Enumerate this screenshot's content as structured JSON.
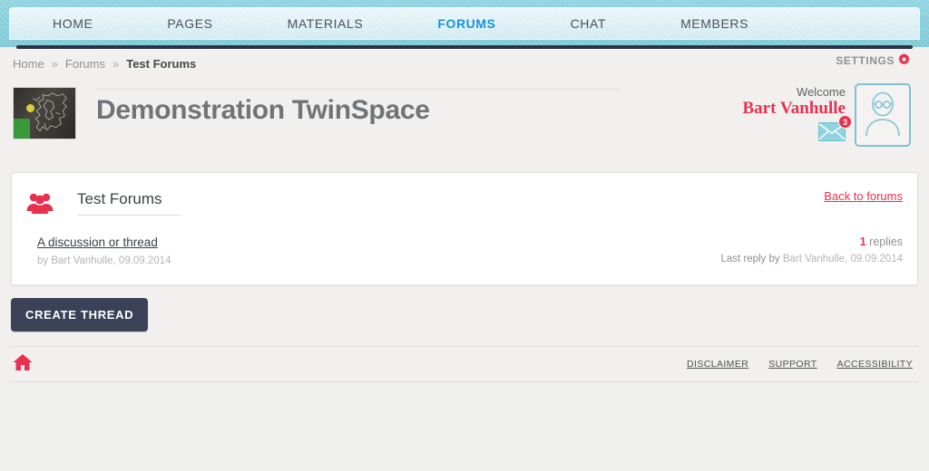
{
  "nav": {
    "items": [
      {
        "label": "HOME",
        "active": false
      },
      {
        "label": "PAGES",
        "active": false
      },
      {
        "label": "MATERIALS",
        "active": false
      },
      {
        "label": "FORUMS",
        "active": true
      },
      {
        "label": "CHAT",
        "active": false
      },
      {
        "label": "MEMBERS",
        "active": false
      }
    ]
  },
  "breadcrumb": {
    "home": "Home",
    "sep1": "»",
    "forums": "Forums",
    "sep2": "»",
    "current": "Test Forums"
  },
  "settings": {
    "label": "SETTINGS",
    "icon": "gear-icon"
  },
  "header": {
    "title": "Demonstration TwinSpace",
    "project_image_alt": "project-thumbnail"
  },
  "user": {
    "welcome": "Welcome",
    "name": "Bart Vanhulle",
    "messages_count": "3",
    "mail_icon": "envelope-icon",
    "avatar_icon": "user-avatar-icon"
  },
  "forum": {
    "icon": "group-icon",
    "title": "Test Forums",
    "back_link": "Back to forums",
    "threads": [
      {
        "title": "A discussion or thread",
        "meta": "by Bart Vanhulle, 09.09.2014",
        "replies_count": "1",
        "replies_word": "replies",
        "last_reply_prefix": "Last reply by",
        "last_reply_author": "Bart Vanhulle, 09.09.2014"
      }
    ],
    "create_button": "CREATE THREAD"
  },
  "footer": {
    "home_icon": "home-icon",
    "links": [
      "DISCLAIMER",
      "SUPPORT",
      "ACCESSIBILITY"
    ]
  },
  "colors": {
    "accent_red": "#e8304f",
    "nav_active_blue": "#1c93d6",
    "teal": "#7ec3d2",
    "button_navy": "#3b4258"
  }
}
